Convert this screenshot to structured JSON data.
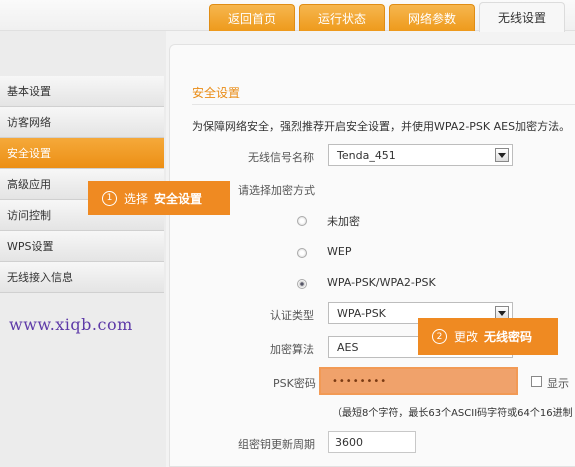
{
  "tabs": [
    {
      "label": "返回首页"
    },
    {
      "label": "运行状态"
    },
    {
      "label": "网络参数"
    },
    {
      "label": "无线设置"
    }
  ],
  "sidebar": {
    "items": [
      {
        "label": "基本设置"
      },
      {
        "label": "访客网络"
      },
      {
        "label": "安全设置"
      },
      {
        "label": "高级应用"
      },
      {
        "label": "访问控制"
      },
      {
        "label": "WPS设置"
      },
      {
        "label": "无线接入信息"
      }
    ]
  },
  "main": {
    "title": "安全设置",
    "description": "为保障网络安全，强烈推荐开启安全设置，并使用WPA2-PSK AES加密方法。",
    "ssid_label": "无线信号名称",
    "ssid_value": "Tenda_451",
    "encrypt_label": "请选择加密方式",
    "radio_none": "未加密",
    "radio_wep": "WEP",
    "radio_wpa": "WPA-PSK/WPA2-PSK",
    "auth_label": "认证类型",
    "auth_value": "WPA-PSK",
    "algo_label": "加密算法",
    "algo_value": "AES",
    "psk_label": "PSK密码",
    "psk_value": "••••••••",
    "show_label": "显示",
    "hint": "（最短8个字符，最长63个ASCII码字符或64个16进制",
    "rekey_label": "组密钥更新周期",
    "rekey_value": "3600"
  },
  "callouts": {
    "one": {
      "num": "1",
      "text": "选择",
      "bold": "安全设置"
    },
    "two": {
      "num": "2",
      "text": "更改",
      "bold": "无线密码"
    }
  },
  "watermark": "www.xiqb.com",
  "colors": {
    "accent": "#ef8a22",
    "title": "#e98c16"
  }
}
